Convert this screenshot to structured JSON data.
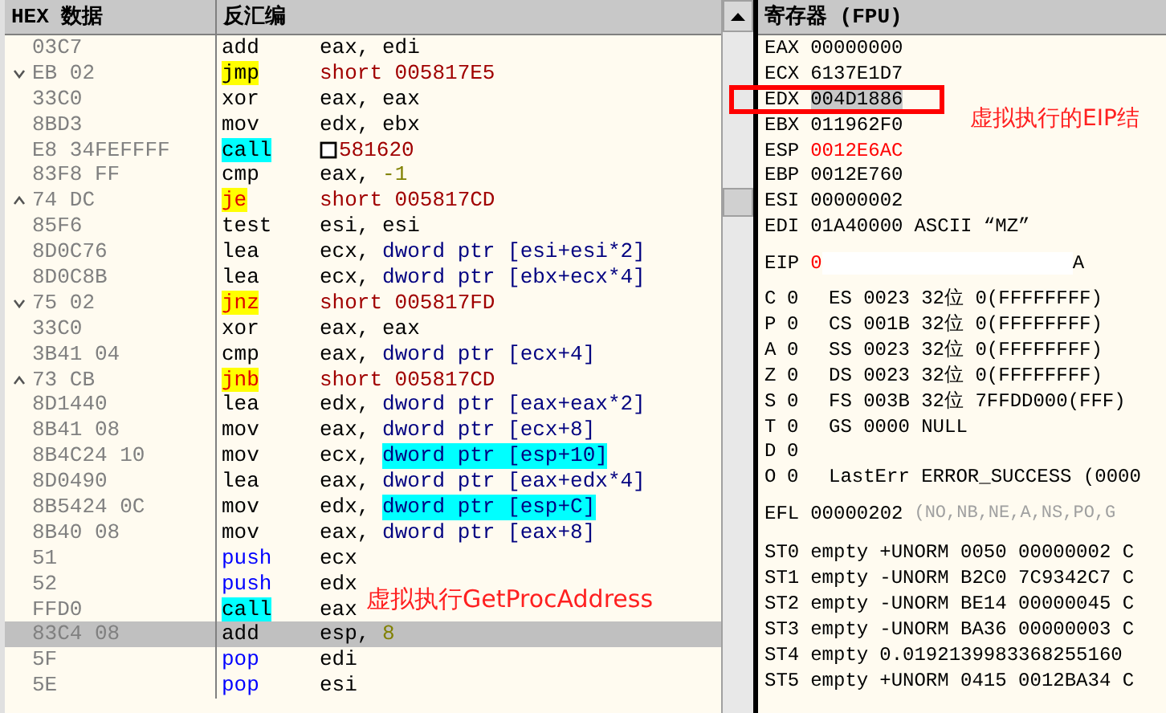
{
  "disasm": {
    "columns": [
      "HEX 数据",
      "反汇编"
    ],
    "rows": [
      {
        "jumps_up": false,
        "jumps_down": false,
        "hex": "03C7",
        "mnemonic": "add",
        "kind": "plain",
        "operands": [
          {
            "text": "eax, edi",
            "kind": "plain"
          }
        ],
        "selected": false
      },
      {
        "jumps_up": false,
        "jumps_down": true,
        "hex": "EB 02",
        "mnemonic": "jmp",
        "kind": "jump",
        "operands": [
          {
            "text": "short 005817E5",
            "kind": "addr"
          }
        ],
        "selected": false
      },
      {
        "jumps_up": false,
        "jumps_down": false,
        "hex": "33C0",
        "mnemonic": "xor",
        "kind": "plain",
        "operands": [
          {
            "text": "eax, eax",
            "kind": "plain"
          }
        ],
        "selected": false
      },
      {
        "jumps_up": false,
        "jumps_down": false,
        "hex": "8BD3",
        "mnemonic": "mov",
        "kind": "plain",
        "operands": [
          {
            "text": "edx, ebx",
            "kind": "plain"
          }
        ],
        "selected": false
      },
      {
        "jumps_up": false,
        "jumps_down": false,
        "hex": "E8 34FEFFFF",
        "mnemonic": "call",
        "kind": "call",
        "cursor": true,
        "operands": [
          {
            "text": "581620",
            "kind": "addr"
          }
        ],
        "selected": false
      },
      {
        "jumps_up": false,
        "jumps_down": false,
        "hex": "83F8 FF",
        "mnemonic": "cmp",
        "kind": "plain",
        "operands": [
          {
            "text": "eax, ",
            "kind": "plain"
          },
          {
            "text": "-1",
            "kind": "const"
          }
        ],
        "selected": false
      },
      {
        "jumps_up": true,
        "jumps_down": false,
        "hex": "74 DC",
        "mnemonic": "je",
        "kind": "cond",
        "operands": [
          {
            "text": "short 005817CD",
            "kind": "addr"
          }
        ],
        "selected": false
      },
      {
        "jumps_up": false,
        "jumps_down": false,
        "hex": "85F6",
        "mnemonic": "test",
        "kind": "plain",
        "operands": [
          {
            "text": "esi, esi",
            "kind": "plain"
          }
        ],
        "selected": false
      },
      {
        "jumps_up": false,
        "jumps_down": false,
        "hex": "8D0C76",
        "mnemonic": "lea",
        "kind": "plain",
        "operands": [
          {
            "text": "ecx, ",
            "kind": "plain"
          },
          {
            "text": "dword ptr [esi+esi*2]",
            "kind": "mem"
          }
        ],
        "selected": false
      },
      {
        "jumps_up": false,
        "jumps_down": false,
        "hex": "8D0C8B",
        "mnemonic": "lea",
        "kind": "plain",
        "operands": [
          {
            "text": "ecx, ",
            "kind": "plain"
          },
          {
            "text": "dword ptr [ebx+ecx*4]",
            "kind": "mem"
          }
        ],
        "selected": false
      },
      {
        "jumps_up": false,
        "jumps_down": true,
        "hex": "75 02",
        "mnemonic": "jnz",
        "kind": "cond",
        "operands": [
          {
            "text": "short 005817FD",
            "kind": "addr"
          }
        ],
        "selected": false
      },
      {
        "jumps_up": false,
        "jumps_down": false,
        "hex": "33C0",
        "mnemonic": "xor",
        "kind": "plain",
        "operands": [
          {
            "text": "eax, eax",
            "kind": "plain"
          }
        ],
        "selected": false
      },
      {
        "jumps_up": false,
        "jumps_down": false,
        "hex": "3B41 04",
        "mnemonic": "cmp",
        "kind": "plain",
        "operands": [
          {
            "text": "eax, ",
            "kind": "plain"
          },
          {
            "text": "dword ptr [ecx+4]",
            "kind": "mem"
          }
        ],
        "selected": false
      },
      {
        "jumps_up": true,
        "jumps_down": false,
        "hex": "73 CB",
        "mnemonic": "jnb",
        "kind": "cond",
        "operands": [
          {
            "text": "short 005817CD",
            "kind": "addr"
          }
        ],
        "selected": false
      },
      {
        "jumps_up": false,
        "jumps_down": false,
        "hex": "8D1440",
        "mnemonic": "lea",
        "kind": "plain",
        "operands": [
          {
            "text": "edx, ",
            "kind": "plain"
          },
          {
            "text": "dword ptr [eax+eax*2]",
            "kind": "mem"
          }
        ],
        "selected": false
      },
      {
        "jumps_up": false,
        "jumps_down": false,
        "hex": "8B41 08",
        "mnemonic": "mov",
        "kind": "plain",
        "operands": [
          {
            "text": "eax, ",
            "kind": "plain"
          },
          {
            "text": "dword ptr [ecx+8]",
            "kind": "mem"
          }
        ],
        "selected": false
      },
      {
        "jumps_up": false,
        "jumps_down": false,
        "hex": "8B4C24 10",
        "mnemonic": "mov",
        "kind": "plain",
        "operands": [
          {
            "text": "ecx, ",
            "kind": "plain"
          },
          {
            "text": "dword ptr [esp+10]",
            "kind": "stack"
          }
        ],
        "selected": false
      },
      {
        "jumps_up": false,
        "jumps_down": false,
        "hex": "8D0490",
        "mnemonic": "lea",
        "kind": "plain",
        "operands": [
          {
            "text": "eax, ",
            "kind": "plain"
          },
          {
            "text": "dword ptr [eax+edx*4]",
            "kind": "mem"
          }
        ],
        "selected": false
      },
      {
        "jumps_up": false,
        "jumps_down": false,
        "hex": "8B5424 0C",
        "mnemonic": "mov",
        "kind": "plain",
        "operands": [
          {
            "text": "edx, ",
            "kind": "plain"
          },
          {
            "text": "dword ptr [esp+C]",
            "kind": "stack"
          }
        ],
        "selected": false
      },
      {
        "jumps_up": false,
        "jumps_down": false,
        "hex": "8B40 08",
        "mnemonic": "mov",
        "kind": "plain",
        "operands": [
          {
            "text": "eax, ",
            "kind": "plain"
          },
          {
            "text": "dword ptr [eax+8]",
            "kind": "mem"
          }
        ],
        "selected": false
      },
      {
        "jumps_up": false,
        "jumps_down": false,
        "hex": "51",
        "mnemonic": "push",
        "kind": "stackop",
        "operands": [
          {
            "text": "ecx",
            "kind": "plain"
          }
        ],
        "selected": false
      },
      {
        "jumps_up": false,
        "jumps_down": false,
        "hex": "52",
        "mnemonic": "push",
        "kind": "stackop",
        "operands": [
          {
            "text": "edx",
            "kind": "plain"
          }
        ],
        "selected": false
      },
      {
        "jumps_up": false,
        "jumps_down": false,
        "hex": "FFD0",
        "mnemonic": "call",
        "kind": "call",
        "operands": [
          {
            "text": "eax",
            "kind": "plain"
          }
        ],
        "selected": false
      },
      {
        "jumps_up": false,
        "jumps_down": false,
        "hex": "83C4 08",
        "mnemonic": "add",
        "kind": "plain",
        "operands": [
          {
            "text": "esp, ",
            "kind": "plain"
          },
          {
            "text": "8",
            "kind": "const"
          }
        ],
        "selected": true
      },
      {
        "jumps_up": false,
        "jumps_down": false,
        "hex": "5F",
        "mnemonic": "pop",
        "kind": "stackop",
        "operands": [
          {
            "text": "edi",
            "kind": "plain"
          }
        ],
        "selected": false
      },
      {
        "jumps_up": false,
        "jumps_down": false,
        "hex": "5E",
        "mnemonic": "pop",
        "kind": "stackop",
        "operands": [
          {
            "text": "esi",
            "kind": "plain"
          }
        ],
        "selected": false
      }
    ],
    "annotation": "虚拟执行GetProcAddress"
  },
  "registers": {
    "title": "寄存器 (FPU)",
    "regs": [
      {
        "name": "EAX",
        "value": "00000000",
        "changed": false,
        "selected": false,
        "boxed": false
      },
      {
        "name": "ECX",
        "value": "6137E1D7",
        "changed": false,
        "selected": false,
        "boxed": false
      },
      {
        "name": "EDX",
        "value": "004D1886",
        "changed": false,
        "selected": true,
        "boxed": true
      },
      {
        "name": "EBX",
        "value": "011962F0",
        "changed": false,
        "selected": false,
        "boxed": false
      },
      {
        "name": "ESP",
        "value": "0012E6AC",
        "changed": true,
        "selected": false,
        "boxed": false
      },
      {
        "name": "EBP",
        "value": "0012E760",
        "changed": false,
        "selected": false,
        "boxed": false
      },
      {
        "name": "ESI",
        "value": "00000002",
        "changed": false,
        "selected": false,
        "boxed": false
      },
      {
        "name": "EDI",
        "value": "01A40000",
        "comment": "ASCII “MZ”",
        "changed": false,
        "selected": false,
        "boxed": false
      }
    ],
    "annotation": "虚拟执行的EIP结",
    "eip": {
      "name": "EIP",
      "value_start": "0",
      "value_end": "A",
      "changed": true
    },
    "flags": [
      {
        "flag": "C",
        "value": "0",
        "info": "ES 0023 32位 0(FFFFFFFF)"
      },
      {
        "flag": "P",
        "value": "0",
        "info": "CS 001B 32位 0(FFFFFFFF)"
      },
      {
        "flag": "A",
        "value": "0",
        "info": "SS 0023 32位 0(FFFFFFFF)"
      },
      {
        "flag": "Z",
        "value": "0",
        "info": "DS 0023 32位 0(FFFFFFFF)"
      },
      {
        "flag": "S",
        "value": "0",
        "info": "FS 003B 32位 7FFDD000(FFF)"
      },
      {
        "flag": "T",
        "value": "0",
        "info": "GS 0000 NULL"
      },
      {
        "flag": "D",
        "value": "0"
      },
      {
        "flag": "O",
        "value": "0",
        "info": "LastErr ERROR_SUCCESS (0000"
      }
    ],
    "efl": {
      "name": "EFL",
      "value": "00000202",
      "detail": "(NO,NB,NE,A,NS,PO,G"
    },
    "fpu": [
      {
        "name": "ST0",
        "tag": "empty",
        "value": "+UNORM 0050 00000002 C"
      },
      {
        "name": "ST1",
        "tag": "empty",
        "value": "-UNORM B2C0 7C9342C7 C"
      },
      {
        "name": "ST2",
        "tag": "empty",
        "value": "-UNORM BE14 00000045 C"
      },
      {
        "name": "ST3",
        "tag": "empty",
        "value": "-UNORM BA36 00000003 C"
      },
      {
        "name": "ST4",
        "tag": "empty",
        "value": "0.0192139983368255160"
      },
      {
        "name": "ST5",
        "tag": "empty",
        "value": "+UNORM 0415 0012BA34 C"
      }
    ]
  }
}
